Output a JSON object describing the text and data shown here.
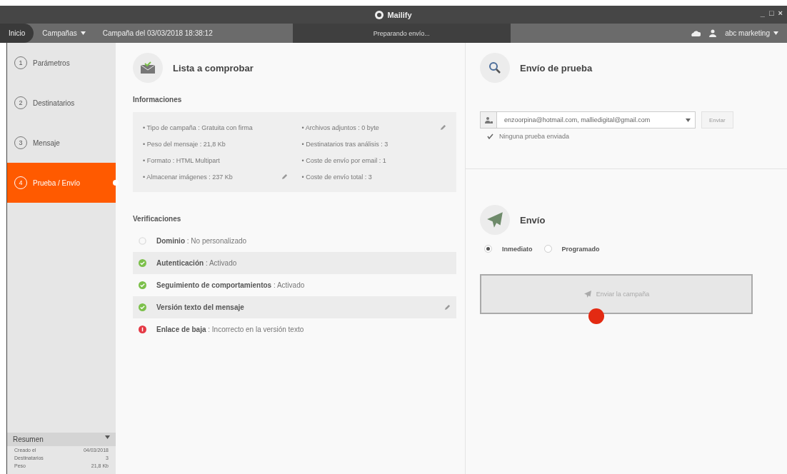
{
  "window": {
    "title": "Mailify",
    "controls": [
      "_",
      "□",
      "×"
    ]
  },
  "nav": {
    "home": "Inicio",
    "menu": "Campañas",
    "campaign": "Campaña del 03/03/2018 18:38:12",
    "status": "Preparando envío...",
    "user": "abc marketing"
  },
  "steps": [
    {
      "number": "1",
      "label": "Parámetros",
      "selected": false
    },
    {
      "number": "2",
      "label": "Destinatarios",
      "selected": false
    },
    {
      "number": "3",
      "label": "Mensaje",
      "selected": false
    },
    {
      "number": "4",
      "label": "Prueba / Envío",
      "selected": true
    }
  ],
  "summary": {
    "title": "Resumen",
    "rows": [
      {
        "label": "Creado el",
        "value": "04/03/2018"
      },
      {
        "label": "Destinatarios",
        "value": "3"
      },
      {
        "label": "Peso",
        "value": "21,8 Kb"
      }
    ]
  },
  "checklist": {
    "title": "Lista a comprobar",
    "info_title": "Informaciones",
    "info_left": [
      {
        "text": "• Tipo de campaña : Gratuita con firma",
        "editable": false
      },
      {
        "text": "• Peso del mensaje : 21,8 Kb",
        "editable": false
      },
      {
        "text": "• Formato : HTML Multipart",
        "editable": false
      },
      {
        "text": "• Almacenar imágenes : 237 Kb",
        "editable": true
      }
    ],
    "info_right": [
      {
        "text": "• Archivos adjuntos : 0 byte",
        "editable": true
      },
      {
        "text": "• Destinatarios tras análisis : 3",
        "editable": false
      },
      {
        "text": "• Coste de envío por email : 1",
        "editable": false
      },
      {
        "text": "• Coste de envío total : 3",
        "editable": false
      }
    ],
    "verif_title": "Verificaciones",
    "verifications": [
      {
        "kind": "neutral",
        "label": "Dominio",
        "detail": " : No personalizado",
        "shaded": false,
        "editable": false
      },
      {
        "kind": "ok",
        "label": "Autenticación",
        "detail": " : Activado",
        "shaded": true,
        "editable": false
      },
      {
        "kind": "ok",
        "label": "Seguimiento de comportamientos",
        "detail": " : Activado",
        "shaded": false,
        "editable": false
      },
      {
        "kind": "ok",
        "label": "Versión texto del mensaje",
        "shaded": true,
        "editable": true
      },
      {
        "kind": "error",
        "label": "Enlace de baja",
        "detail": " : Incorrecto en la versión texto",
        "shaded": false,
        "editable": false
      }
    ]
  },
  "test_send": {
    "title": "Envío de prueba",
    "recipients": "enzoorpina@hotmail.com, malliedigital@gmail.com",
    "button": "Enviar",
    "status": "Ninguna prueba enviada"
  },
  "send": {
    "title": "Envío",
    "options": [
      {
        "label": "Inmediato",
        "selected": true
      },
      {
        "label": "Programado",
        "selected": false
      }
    ],
    "button": "Enviar la campaña"
  }
}
